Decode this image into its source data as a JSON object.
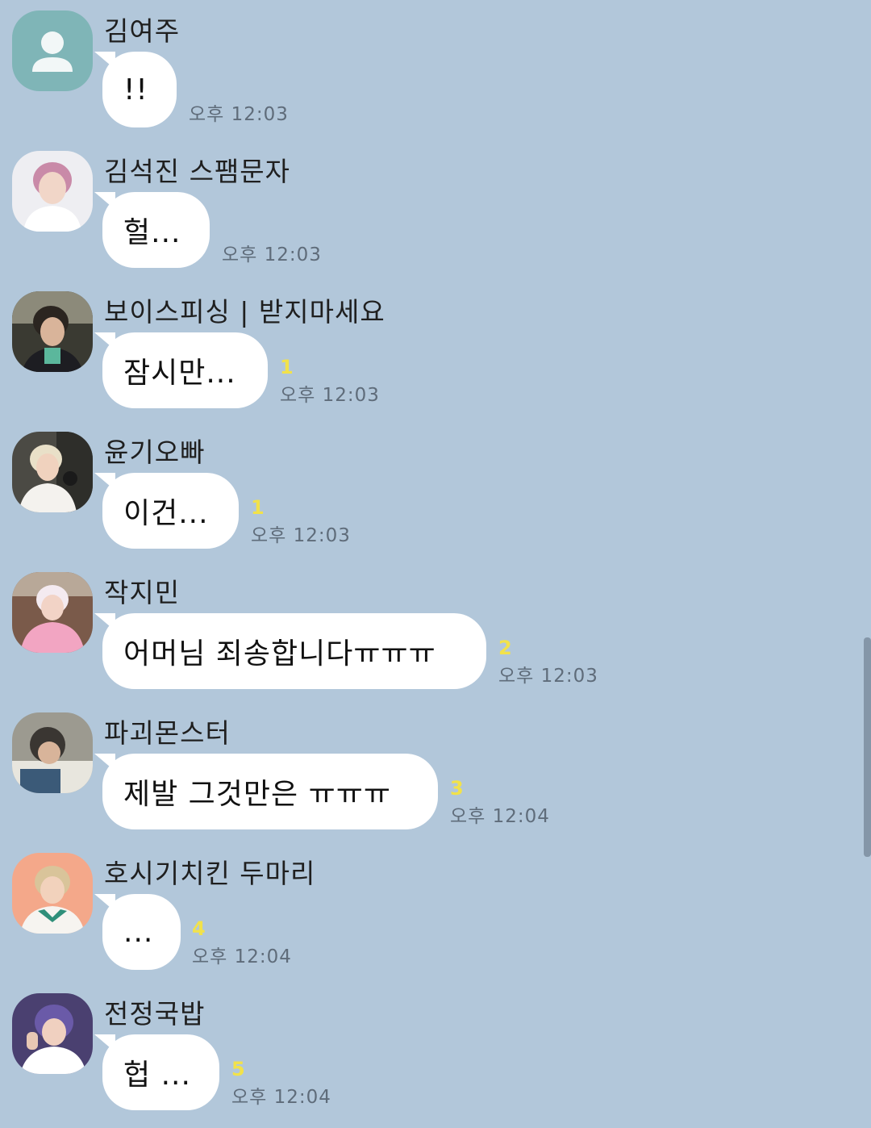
{
  "colors": {
    "background": "#b2c7da",
    "bubble": "#ffffff",
    "unread": "#f2e24a",
    "time": "#5f6c7a"
  },
  "messages": [
    {
      "sender": "김여주",
      "text": "!!",
      "unread": "",
      "time": "오후 12:03",
      "avatar": "default-profile-icon"
    },
    {
      "sender": "김석진 스팸문자",
      "text": "헐...",
      "unread": "",
      "time": "오후 12:03",
      "avatar": "profile-photo"
    },
    {
      "sender": "보이스피싱 | 받지마세요",
      "text": "잠시만...",
      "unread": "1",
      "time": "오후 12:03",
      "avatar": "profile-photo"
    },
    {
      "sender": "윤기오빠",
      "text": "이건...",
      "unread": "1",
      "time": "오후 12:03",
      "avatar": "profile-photo"
    },
    {
      "sender": "작지민",
      "text": "어머님 죄송합니다ㅠㅠㅠ",
      "unread": "2",
      "time": "오후 12:03",
      "avatar": "profile-photo"
    },
    {
      "sender": "파괴몬스터",
      "text": "제발 그것만은 ㅠㅠㅠ",
      "unread": "3",
      "time": "오후 12:04",
      "avatar": "profile-photo"
    },
    {
      "sender": "호시기치킨 두마리",
      "text": "...",
      "unread": "4",
      "time": "오후 12:04",
      "avatar": "profile-photo"
    },
    {
      "sender": "전정국밥",
      "text": "헙 ...",
      "unread": "5",
      "time": "오후 12:04",
      "avatar": "profile-photo"
    }
  ]
}
